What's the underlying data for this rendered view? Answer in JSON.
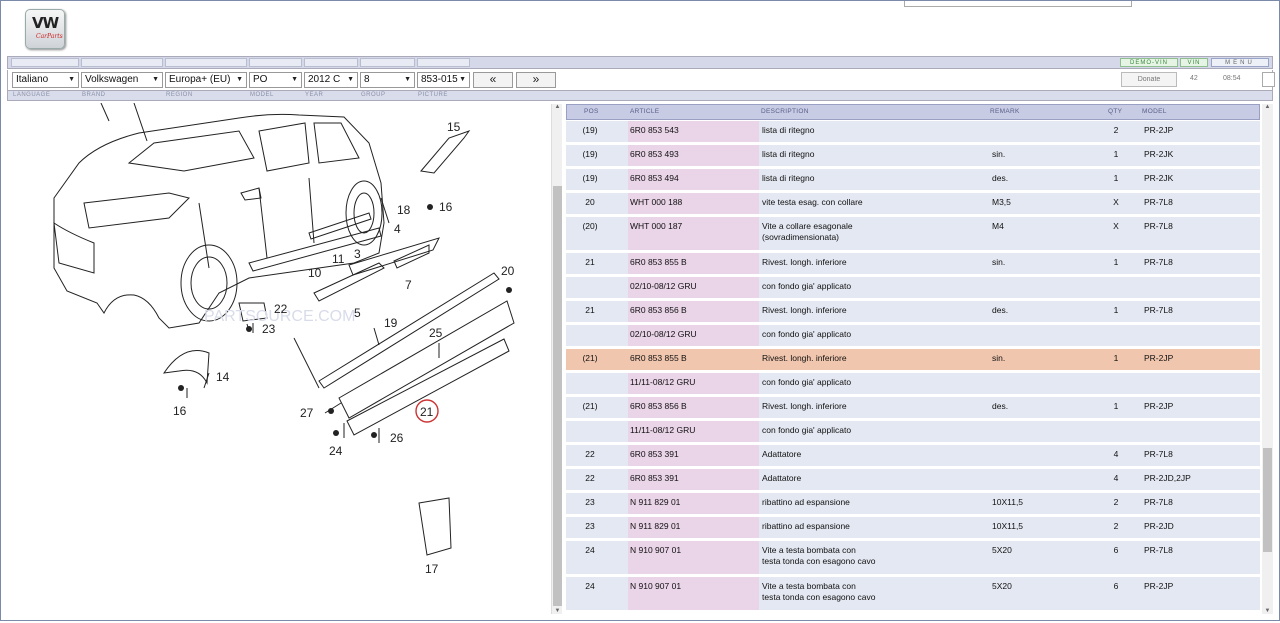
{
  "logo": {
    "text": "VW",
    "subtext": "CarParts"
  },
  "toolbar": {
    "demo_vin": "DEMO-VIN",
    "vin": "VIN",
    "menu": "MENU"
  },
  "selectors": {
    "language": "Italiano",
    "brand": "Volkswagen",
    "region": "Europa+ (EU)",
    "model": "PO",
    "year": "2012  C",
    "group": "8",
    "picture": "853-015",
    "prev": "«",
    "next": "»"
  },
  "info": {
    "donate": "Donate",
    "count": "42",
    "time": "08:54"
  },
  "labels": {
    "language": "LANGUAGE",
    "brand": "BRAND",
    "region": "REGION",
    "model": "MODEL",
    "year": "YEAR",
    "group": "GROUP",
    "picture": "PICTURE"
  },
  "diagram": {
    "callouts": [
      "15",
      "16",
      "18",
      "4",
      "7",
      "20",
      "3",
      "11",
      "10",
      "5",
      "22",
      "23",
      "19",
      "25",
      "14",
      "16",
      "27",
      "21",
      "24",
      "26",
      "17"
    ],
    "watermark": "PARTSOURCE.COM"
  },
  "table": {
    "headers": {
      "pos": "POS",
      "article": "ARTICLE",
      "description": "DESCRIPTION",
      "remark": "REMARK",
      "qty": "QTY",
      "model": "MODEL"
    },
    "rows": [
      {
        "pos": "(19)",
        "article": "6R0 853 543",
        "desc": "lista di ritegno",
        "remark": "",
        "qty": "2",
        "model": "PR-2JP"
      },
      {
        "pos": "(19)",
        "article": "6R0 853 493",
        "desc": "lista di ritegno",
        "remark": "sin.",
        "qty": "1",
        "model": "PR-2JK"
      },
      {
        "pos": "(19)",
        "article": "6R0 853 494",
        "desc": "lista di ritegno",
        "remark": "des.",
        "qty": "1",
        "model": "PR-2JK"
      },
      {
        "pos": "20",
        "article": "WHT 000 188",
        "desc": "vite testa esag. con collare",
        "remark": "M3,5",
        "qty": "X",
        "model": "PR-7L8"
      },
      {
        "pos": "(20)",
        "article": "WHT 000 187",
        "desc": "Vite a collare esagonale\n(sovradimensionata)",
        "remark": "M4",
        "qty": "X",
        "model": "PR-7L8"
      },
      {
        "pos": "21",
        "article": "6R0 853 855 B",
        "desc": "Rivest. longh. inferiore",
        "remark": "sin.",
        "qty": "1",
        "model": "PR-7L8"
      },
      {
        "pos": "",
        "article": "02/10-08/12     GRU",
        "desc": "con fondo gia' applicato",
        "remark": "",
        "qty": "",
        "model": ""
      },
      {
        "pos": "21",
        "article": "6R0 853 856 B",
        "desc": "Rivest. longh. inferiore",
        "remark": "des.",
        "qty": "1",
        "model": "PR-7L8"
      },
      {
        "pos": "",
        "article": "02/10-08/12     GRU",
        "desc": "con fondo gia' applicato",
        "remark": "",
        "qty": "",
        "model": ""
      },
      {
        "pos": "(21)",
        "article": "6R0 853 855 B",
        "desc": "Rivest. longh. inferiore",
        "remark": "sin.",
        "qty": "1",
        "model": "PR-2JP",
        "highlight": true
      },
      {
        "pos": "",
        "article": "11/11-08/12     GRU",
        "desc": "con fondo gia' applicato",
        "remark": "",
        "qty": "",
        "model": ""
      },
      {
        "pos": "(21)",
        "article": "6R0 853 856 B",
        "desc": "Rivest. longh. inferiore",
        "remark": "des.",
        "qty": "1",
        "model": "PR-2JP"
      },
      {
        "pos": "",
        "article": "11/11-08/12     GRU",
        "desc": "con fondo gia' applicato",
        "remark": "",
        "qty": "",
        "model": ""
      },
      {
        "pos": "22",
        "article": "6R0 853 391",
        "desc": "Adattatore",
        "remark": "",
        "qty": "4",
        "model": "PR-7L8"
      },
      {
        "pos": "22",
        "article": "6R0 853 391",
        "desc": "Adattatore",
        "remark": "",
        "qty": "4",
        "model": "PR-2JD,2JP"
      },
      {
        "pos": "23",
        "article": "N    911 829 01",
        "desc": "ribattino ad espansione",
        "remark": "10X11,5",
        "qty": "2",
        "model": "PR-7L8"
      },
      {
        "pos": "23",
        "article": "N    911 829 01",
        "desc": "ribattino ad espansione",
        "remark": "10X11,5",
        "qty": "2",
        "model": "PR-2JD"
      },
      {
        "pos": "24",
        "article": "N    910 907 01",
        "desc": "Vite a testa bombata con\ntesta tonda con esagono cavo",
        "remark": "5X20",
        "qty": "6",
        "model": "PR-7L8"
      },
      {
        "pos": "24",
        "article": "N    910 907 01",
        "desc": "Vite a testa bombata con\ntesta tonda con esagono cavo",
        "remark": "5X20",
        "qty": "6",
        "model": "PR-2JP"
      }
    ]
  }
}
